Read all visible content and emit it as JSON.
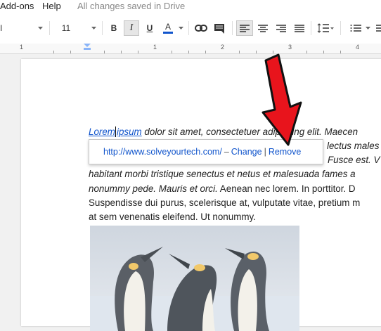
{
  "menubar": {
    "addons": "Add-ons",
    "help": "Help",
    "status": "All changes saved in Drive"
  },
  "toolbar": {
    "font_size": "11",
    "bold": "B",
    "italic": "I",
    "underline": "U",
    "text_color": "A",
    "text_color_accent": "#1155cc"
  },
  "ruler": {
    "marks": [
      "1",
      "1",
      "2",
      "3",
      "4"
    ]
  },
  "document": {
    "line1_link_a": "Lorem",
    "line1_link_b": "ipsum",
    "line1_rest": " dolor sit amet, consectetuer adipiscing elit. Maecen",
    "line2_right": "lectus males",
    "line3_right": "Fusce est. V",
    "line4": "habitant morbi tristique senectus et netus et malesuada fames a",
    "line5_italic": "nonummy pede. Mauris et orci.",
    "line5_rest": " Aenean nec lorem. In porttitor. D",
    "line6": "Suspendisse dui purus, scelerisque at, vulputate vitae, pretium m",
    "line7": "at sem venenatis eleifend. Ut nonummy."
  },
  "link_popup": {
    "url": "http://www.solveyourtech.com/",
    "dash": "–",
    "change": "Change",
    "pipe": "|",
    "remove": "Remove"
  },
  "annotation": {
    "arrow_color": "#e8141c"
  }
}
